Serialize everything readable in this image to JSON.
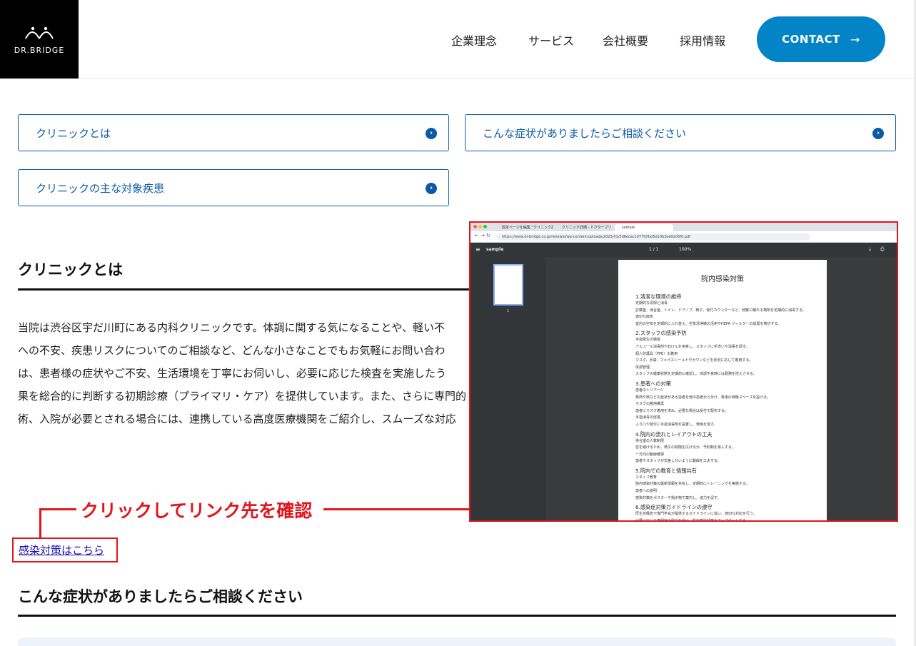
{
  "header": {
    "logo_text": "DR.BRIDGE",
    "nav": [
      {
        "label": "企業理念"
      },
      {
        "label": "サービス"
      },
      {
        "label": "会社概要"
      },
      {
        "label": "採用情報"
      }
    ],
    "contact_label": "CONTACT",
    "contact_arrow": "→"
  },
  "anchors": [
    {
      "label": "クリニックとは"
    },
    {
      "label": "こんな症状がありましたらご相談ください"
    },
    {
      "label": "クリニックの主な対象疾患"
    }
  ],
  "section1": {
    "title": "クリニックとは",
    "lines": [
      "当院は渋谷区宇だ川町にある内科クリニックです。体調に関する気になることや、軽い不",
      "への不安、疾患リスクについてのご相談など、どんな小さなことでもお気軽にお問い合わ",
      "は、患者様の症状やご不安、生活環境を丁寧にお伺いし、必要に応じた検査を実施したう",
      "果を総合的に判断する初期診療（プライマリ・ケア）を提供しています。また、さらに専門的",
      "術、入院が必要とされる場合には、連携している高度医療機関をご紹介し、スムーズな対応"
    ],
    "link_label": "感染対策はこちら"
  },
  "annotation": "クリックしてリンク先を確認",
  "section2": {
    "title": "こんな症状がありましたらご相談ください"
  },
  "screenshot": {
    "tabs": [
      "固定ページを編集 “クリニック詳",
      "クリニック詳細 - ドクターブリ",
      "sample"
    ],
    "url": "https://www.dr-bridge.co.jp/renewal/wp-content/uploads/2025/01/3d6ecac1077f2fbd5d10b3ee9206f0.pdf",
    "file_name": "sample",
    "page_indicator": "1 / 1",
    "zoom": "100%",
    "thumb_label": "1",
    "pdf": {
      "title": "院内感染対策",
      "sections": [
        {
          "heading": "1.清潔な環境の維持",
          "lines": [
            "定期的な清掃と消毒",
            "診察室、待合室、トイレ、ドアノブ、椅子、受付カウンターなど、頻繁に触れる場所を定期的に消毒する。",
            "適切な換気",
            "室内の空気を定期的に入れ替え、空気清浄機の活用やHEPA フィルターの設置を検討する。"
          ]
        },
        {
          "heading": "2.スタッフの感染予防",
          "lines": [
            "手指衛生の徹底",
            "アルコール消毒剤や石けんを用意し、スタッフに手洗いや消毒を促す。",
            "個人防護具（PPE）の着用",
            "マスク、手袋、フェイスシールドやガウンなどを状況に応じて着用する。",
            "体調管理",
            "スタッフの健康状態を定期的に確認し、体調不良時には勤務を控えさせる。"
          ]
        },
        {
          "heading": "3.患者への対策",
          "lines": [
            "患者のトリアージ",
            "発熱や咳などの症状がある患者を他の患者から分け、専用の待機スペースを設ける。",
            "マスクの着用推奨",
            "患者にマスク着用を求め、必要な場合は受付で配布する。",
            "手指消毒の促進",
            "入り口や受付に手指消毒剤を設置し、使用を促す。"
          ]
        },
        {
          "heading": "4.院内の流れとレイアウトの工夫",
          "lines": [
            "待合室の人数制限",
            "密を避けるため、椅子の間隔を広げるか、予約制を導入する。",
            "一方向の動線確保",
            "患者やスタッフが交差しないように動線を工夫する。"
          ]
        },
        {
          "heading": "5.院内での教育と情報共有",
          "lines": [
            "スタッフ教育",
            "院内感染対策の最新情報を共有し、定期的にトレーニングを実施する。",
            "患者への説明",
            "感染対策をポスターや掲示物で案内し、協力を促す。"
          ]
        },
        {
          "heading": "6.感染症対策ガイドラインの遵守",
          "lines": [
            "厚生労働省や専門学会が提供するガイドラインに従い、適切な対応を行う。",
            "必要に応じて専門家の助言を受け、院内感染対策をアップデートする。"
          ]
        }
      ]
    }
  }
}
